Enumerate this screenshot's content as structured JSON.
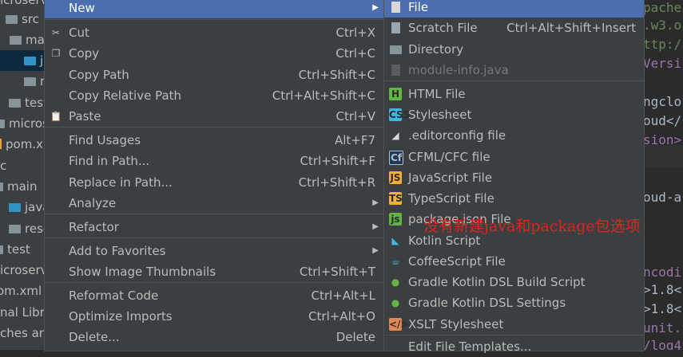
{
  "tree": {
    "items": [
      {
        "label": "src",
        "icon": "folder"
      },
      {
        "label": "mai",
        "icon": "folder"
      },
      {
        "label": "j",
        "icon": "folder-blue",
        "selected": true
      },
      {
        "label": "r",
        "icon": "folder"
      },
      {
        "label": "test",
        "icon": "folder"
      },
      {
        "label": "micros",
        "icon": "folder"
      },
      {
        "label": "pom.x",
        "icon": "file"
      },
      {
        "label": "c",
        "icon": "folder"
      },
      {
        "label": "main",
        "icon": "folder"
      },
      {
        "label": "java",
        "icon": "folder-blue"
      },
      {
        "label": "resc",
        "icon": "folder"
      },
      {
        "label": "test",
        "icon": "folder"
      },
      {
        "label": "icroserv",
        "icon": "folder"
      },
      {
        "label": "om.xml",
        "icon": "file"
      },
      {
        "label": "nal Libra",
        "icon": "folder"
      },
      {
        "label": "ches an",
        "icon": "folder"
      }
    ],
    "top_fragment": "icroserv"
  },
  "menu1": {
    "items": [
      {
        "label": "New",
        "shortcut": "",
        "submenu": true,
        "icon": ""
      },
      {
        "label": "Cut",
        "shortcut": "Ctrl+X",
        "icon": "scissors-icon"
      },
      {
        "label": "Copy",
        "shortcut": "Ctrl+C",
        "icon": "copy-icon"
      },
      {
        "label": "Copy Path",
        "shortcut": "Ctrl+Shift+C",
        "icon": ""
      },
      {
        "label": "Copy Relative Path",
        "shortcut": "Ctrl+Alt+Shift+C",
        "icon": ""
      },
      {
        "label": "Paste",
        "shortcut": "Ctrl+V",
        "icon": "paste-icon"
      },
      {
        "label": "Find Usages",
        "shortcut": "Alt+F7",
        "icon": ""
      },
      {
        "label": "Find in Path...",
        "shortcut": "Ctrl+Shift+F",
        "icon": ""
      },
      {
        "label": "Replace in Path...",
        "shortcut": "Ctrl+Shift+R",
        "icon": ""
      },
      {
        "label": "Analyze",
        "shortcut": "",
        "submenu": true,
        "icon": ""
      },
      {
        "label": "Refactor",
        "shortcut": "",
        "submenu": true,
        "icon": ""
      },
      {
        "label": "Add to Favorites",
        "shortcut": "",
        "submenu": true,
        "icon": ""
      },
      {
        "label": "Show Image Thumbnails",
        "shortcut": "Ctrl+Shift+T",
        "icon": ""
      },
      {
        "label": "Reformat Code",
        "shortcut": "Ctrl+Alt+L",
        "icon": ""
      },
      {
        "label": "Optimize Imports",
        "shortcut": "Ctrl+Alt+O",
        "icon": ""
      },
      {
        "label": "Delete...",
        "shortcut": "Delete",
        "icon": ""
      }
    ]
  },
  "menu2": {
    "items": [
      {
        "label": "File",
        "icon": "file-icon"
      },
      {
        "label": "Scratch File",
        "shortcut": "Ctrl+Alt+Shift+Insert",
        "icon": "scratch-file-icon"
      },
      {
        "label": "Directory",
        "icon": "folder-icon"
      },
      {
        "label": "module-info.java",
        "icon": "java-module-icon",
        "disabled": true
      },
      {
        "label": "HTML File",
        "icon": "html-file-icon"
      },
      {
        "label": "Stylesheet",
        "icon": "css-file-icon"
      },
      {
        "label": ".editorconfig file",
        "icon": "editorconfig-icon"
      },
      {
        "label": "CFML/CFC file",
        "icon": "cfml-file-icon"
      },
      {
        "label": "JavaScript File",
        "icon": "javascript-file-icon"
      },
      {
        "label": "TypeScript File",
        "icon": "typescript-file-icon"
      },
      {
        "label": "package.json File",
        "icon": "package-json-icon"
      },
      {
        "label": "Kotlin Script",
        "icon": "kotlin-script-icon"
      },
      {
        "label": "CoffeeScript File",
        "icon": "coffeescript-file-icon"
      },
      {
        "label": "Gradle Kotlin DSL Build Script",
        "icon": "gradle-icon"
      },
      {
        "label": "Gradle Kotlin DSL Settings",
        "icon": "gradle-icon"
      },
      {
        "label": "XSLT Stylesheet",
        "icon": "xslt-icon"
      },
      {
        "label": "Edit File Templates...",
        "icon": ""
      }
    ]
  },
  "editor": {
    "lines": [
      {
        "text": "pache",
        "color": "#6a8759"
      },
      {
        "text": ".w3.o",
        "color": "#6a8759"
      },
      {
        "text": "ttp:/",
        "color": "#6a8759"
      },
      {
        "text": "Versi",
        "color": "#9876aa"
      },
      {
        "text": "ngclo",
        "color": "#a9b7c6"
      },
      {
        "text": "oud</",
        "color": "#a9b7c6"
      },
      {
        "text": "sion>",
        "color": "#9876aa"
      },
      {
        "text": "oud-a",
        "color": "#a9b7c6"
      },
      {
        "text": "ncodi",
        "color": "#9876aa"
      },
      {
        "text": ">1.8<",
        "color": "#a9b7c6"
      },
      {
        "text": ">1.8<",
        "color": "#a9b7c6"
      },
      {
        "text": "unit.",
        "color": "#9876aa"
      },
      {
        "text": "/log4",
        "color": "#9876aa"
      }
    ]
  },
  "annotation": {
    "text": "没有新建java和package包选项",
    "color": "#e0241d"
  }
}
